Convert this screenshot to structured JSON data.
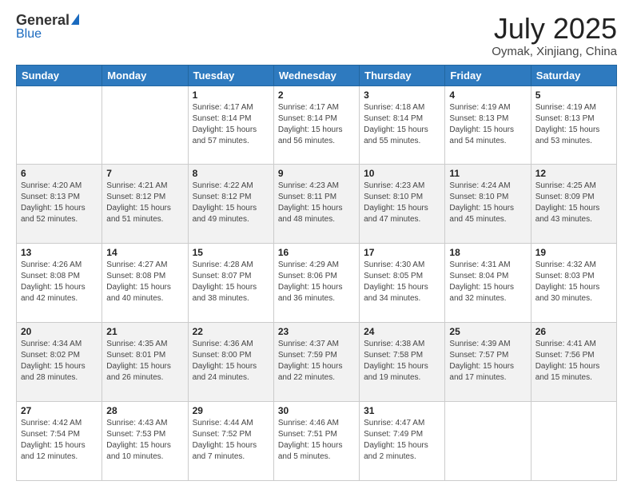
{
  "header": {
    "logo_general": "General",
    "logo_blue": "Blue",
    "title": "July 2025",
    "subtitle": "Oymak, Xinjiang, China"
  },
  "days_of_week": [
    "Sunday",
    "Monday",
    "Tuesday",
    "Wednesday",
    "Thursday",
    "Friday",
    "Saturday"
  ],
  "weeks": [
    [
      {
        "day": "",
        "sunrise": "",
        "sunset": "",
        "daylight": ""
      },
      {
        "day": "",
        "sunrise": "",
        "sunset": "",
        "daylight": ""
      },
      {
        "day": "1",
        "sunrise": "Sunrise: 4:17 AM",
        "sunset": "Sunset: 8:14 PM",
        "daylight": "Daylight: 15 hours and 57 minutes."
      },
      {
        "day": "2",
        "sunrise": "Sunrise: 4:17 AM",
        "sunset": "Sunset: 8:14 PM",
        "daylight": "Daylight: 15 hours and 56 minutes."
      },
      {
        "day": "3",
        "sunrise": "Sunrise: 4:18 AM",
        "sunset": "Sunset: 8:14 PM",
        "daylight": "Daylight: 15 hours and 55 minutes."
      },
      {
        "day": "4",
        "sunrise": "Sunrise: 4:19 AM",
        "sunset": "Sunset: 8:13 PM",
        "daylight": "Daylight: 15 hours and 54 minutes."
      },
      {
        "day": "5",
        "sunrise": "Sunrise: 4:19 AM",
        "sunset": "Sunset: 8:13 PM",
        "daylight": "Daylight: 15 hours and 53 minutes."
      }
    ],
    [
      {
        "day": "6",
        "sunrise": "Sunrise: 4:20 AM",
        "sunset": "Sunset: 8:13 PM",
        "daylight": "Daylight: 15 hours and 52 minutes."
      },
      {
        "day": "7",
        "sunrise": "Sunrise: 4:21 AM",
        "sunset": "Sunset: 8:12 PM",
        "daylight": "Daylight: 15 hours and 51 minutes."
      },
      {
        "day": "8",
        "sunrise": "Sunrise: 4:22 AM",
        "sunset": "Sunset: 8:12 PM",
        "daylight": "Daylight: 15 hours and 49 minutes."
      },
      {
        "day": "9",
        "sunrise": "Sunrise: 4:23 AM",
        "sunset": "Sunset: 8:11 PM",
        "daylight": "Daylight: 15 hours and 48 minutes."
      },
      {
        "day": "10",
        "sunrise": "Sunrise: 4:23 AM",
        "sunset": "Sunset: 8:10 PM",
        "daylight": "Daylight: 15 hours and 47 minutes."
      },
      {
        "day": "11",
        "sunrise": "Sunrise: 4:24 AM",
        "sunset": "Sunset: 8:10 PM",
        "daylight": "Daylight: 15 hours and 45 minutes."
      },
      {
        "day": "12",
        "sunrise": "Sunrise: 4:25 AM",
        "sunset": "Sunset: 8:09 PM",
        "daylight": "Daylight: 15 hours and 43 minutes."
      }
    ],
    [
      {
        "day": "13",
        "sunrise": "Sunrise: 4:26 AM",
        "sunset": "Sunset: 8:08 PM",
        "daylight": "Daylight: 15 hours and 42 minutes."
      },
      {
        "day": "14",
        "sunrise": "Sunrise: 4:27 AM",
        "sunset": "Sunset: 8:08 PM",
        "daylight": "Daylight: 15 hours and 40 minutes."
      },
      {
        "day": "15",
        "sunrise": "Sunrise: 4:28 AM",
        "sunset": "Sunset: 8:07 PM",
        "daylight": "Daylight: 15 hours and 38 minutes."
      },
      {
        "day": "16",
        "sunrise": "Sunrise: 4:29 AM",
        "sunset": "Sunset: 8:06 PM",
        "daylight": "Daylight: 15 hours and 36 minutes."
      },
      {
        "day": "17",
        "sunrise": "Sunrise: 4:30 AM",
        "sunset": "Sunset: 8:05 PM",
        "daylight": "Daylight: 15 hours and 34 minutes."
      },
      {
        "day": "18",
        "sunrise": "Sunrise: 4:31 AM",
        "sunset": "Sunset: 8:04 PM",
        "daylight": "Daylight: 15 hours and 32 minutes."
      },
      {
        "day": "19",
        "sunrise": "Sunrise: 4:32 AM",
        "sunset": "Sunset: 8:03 PM",
        "daylight": "Daylight: 15 hours and 30 minutes."
      }
    ],
    [
      {
        "day": "20",
        "sunrise": "Sunrise: 4:34 AM",
        "sunset": "Sunset: 8:02 PM",
        "daylight": "Daylight: 15 hours and 28 minutes."
      },
      {
        "day": "21",
        "sunrise": "Sunrise: 4:35 AM",
        "sunset": "Sunset: 8:01 PM",
        "daylight": "Daylight: 15 hours and 26 minutes."
      },
      {
        "day": "22",
        "sunrise": "Sunrise: 4:36 AM",
        "sunset": "Sunset: 8:00 PM",
        "daylight": "Daylight: 15 hours and 24 minutes."
      },
      {
        "day": "23",
        "sunrise": "Sunrise: 4:37 AM",
        "sunset": "Sunset: 7:59 PM",
        "daylight": "Daylight: 15 hours and 22 minutes."
      },
      {
        "day": "24",
        "sunrise": "Sunrise: 4:38 AM",
        "sunset": "Sunset: 7:58 PM",
        "daylight": "Daylight: 15 hours and 19 minutes."
      },
      {
        "day": "25",
        "sunrise": "Sunrise: 4:39 AM",
        "sunset": "Sunset: 7:57 PM",
        "daylight": "Daylight: 15 hours and 17 minutes."
      },
      {
        "day": "26",
        "sunrise": "Sunrise: 4:41 AM",
        "sunset": "Sunset: 7:56 PM",
        "daylight": "Daylight: 15 hours and 15 minutes."
      }
    ],
    [
      {
        "day": "27",
        "sunrise": "Sunrise: 4:42 AM",
        "sunset": "Sunset: 7:54 PM",
        "daylight": "Daylight: 15 hours and 12 minutes."
      },
      {
        "day": "28",
        "sunrise": "Sunrise: 4:43 AM",
        "sunset": "Sunset: 7:53 PM",
        "daylight": "Daylight: 15 hours and 10 minutes."
      },
      {
        "day": "29",
        "sunrise": "Sunrise: 4:44 AM",
        "sunset": "Sunset: 7:52 PM",
        "daylight": "Daylight: 15 hours and 7 minutes."
      },
      {
        "day": "30",
        "sunrise": "Sunrise: 4:46 AM",
        "sunset": "Sunset: 7:51 PM",
        "daylight": "Daylight: 15 hours and 5 minutes."
      },
      {
        "day": "31",
        "sunrise": "Sunrise: 4:47 AM",
        "sunset": "Sunset: 7:49 PM",
        "daylight": "Daylight: 15 hours and 2 minutes."
      },
      {
        "day": "",
        "sunrise": "",
        "sunset": "",
        "daylight": ""
      },
      {
        "day": "",
        "sunrise": "",
        "sunset": "",
        "daylight": ""
      }
    ]
  ]
}
